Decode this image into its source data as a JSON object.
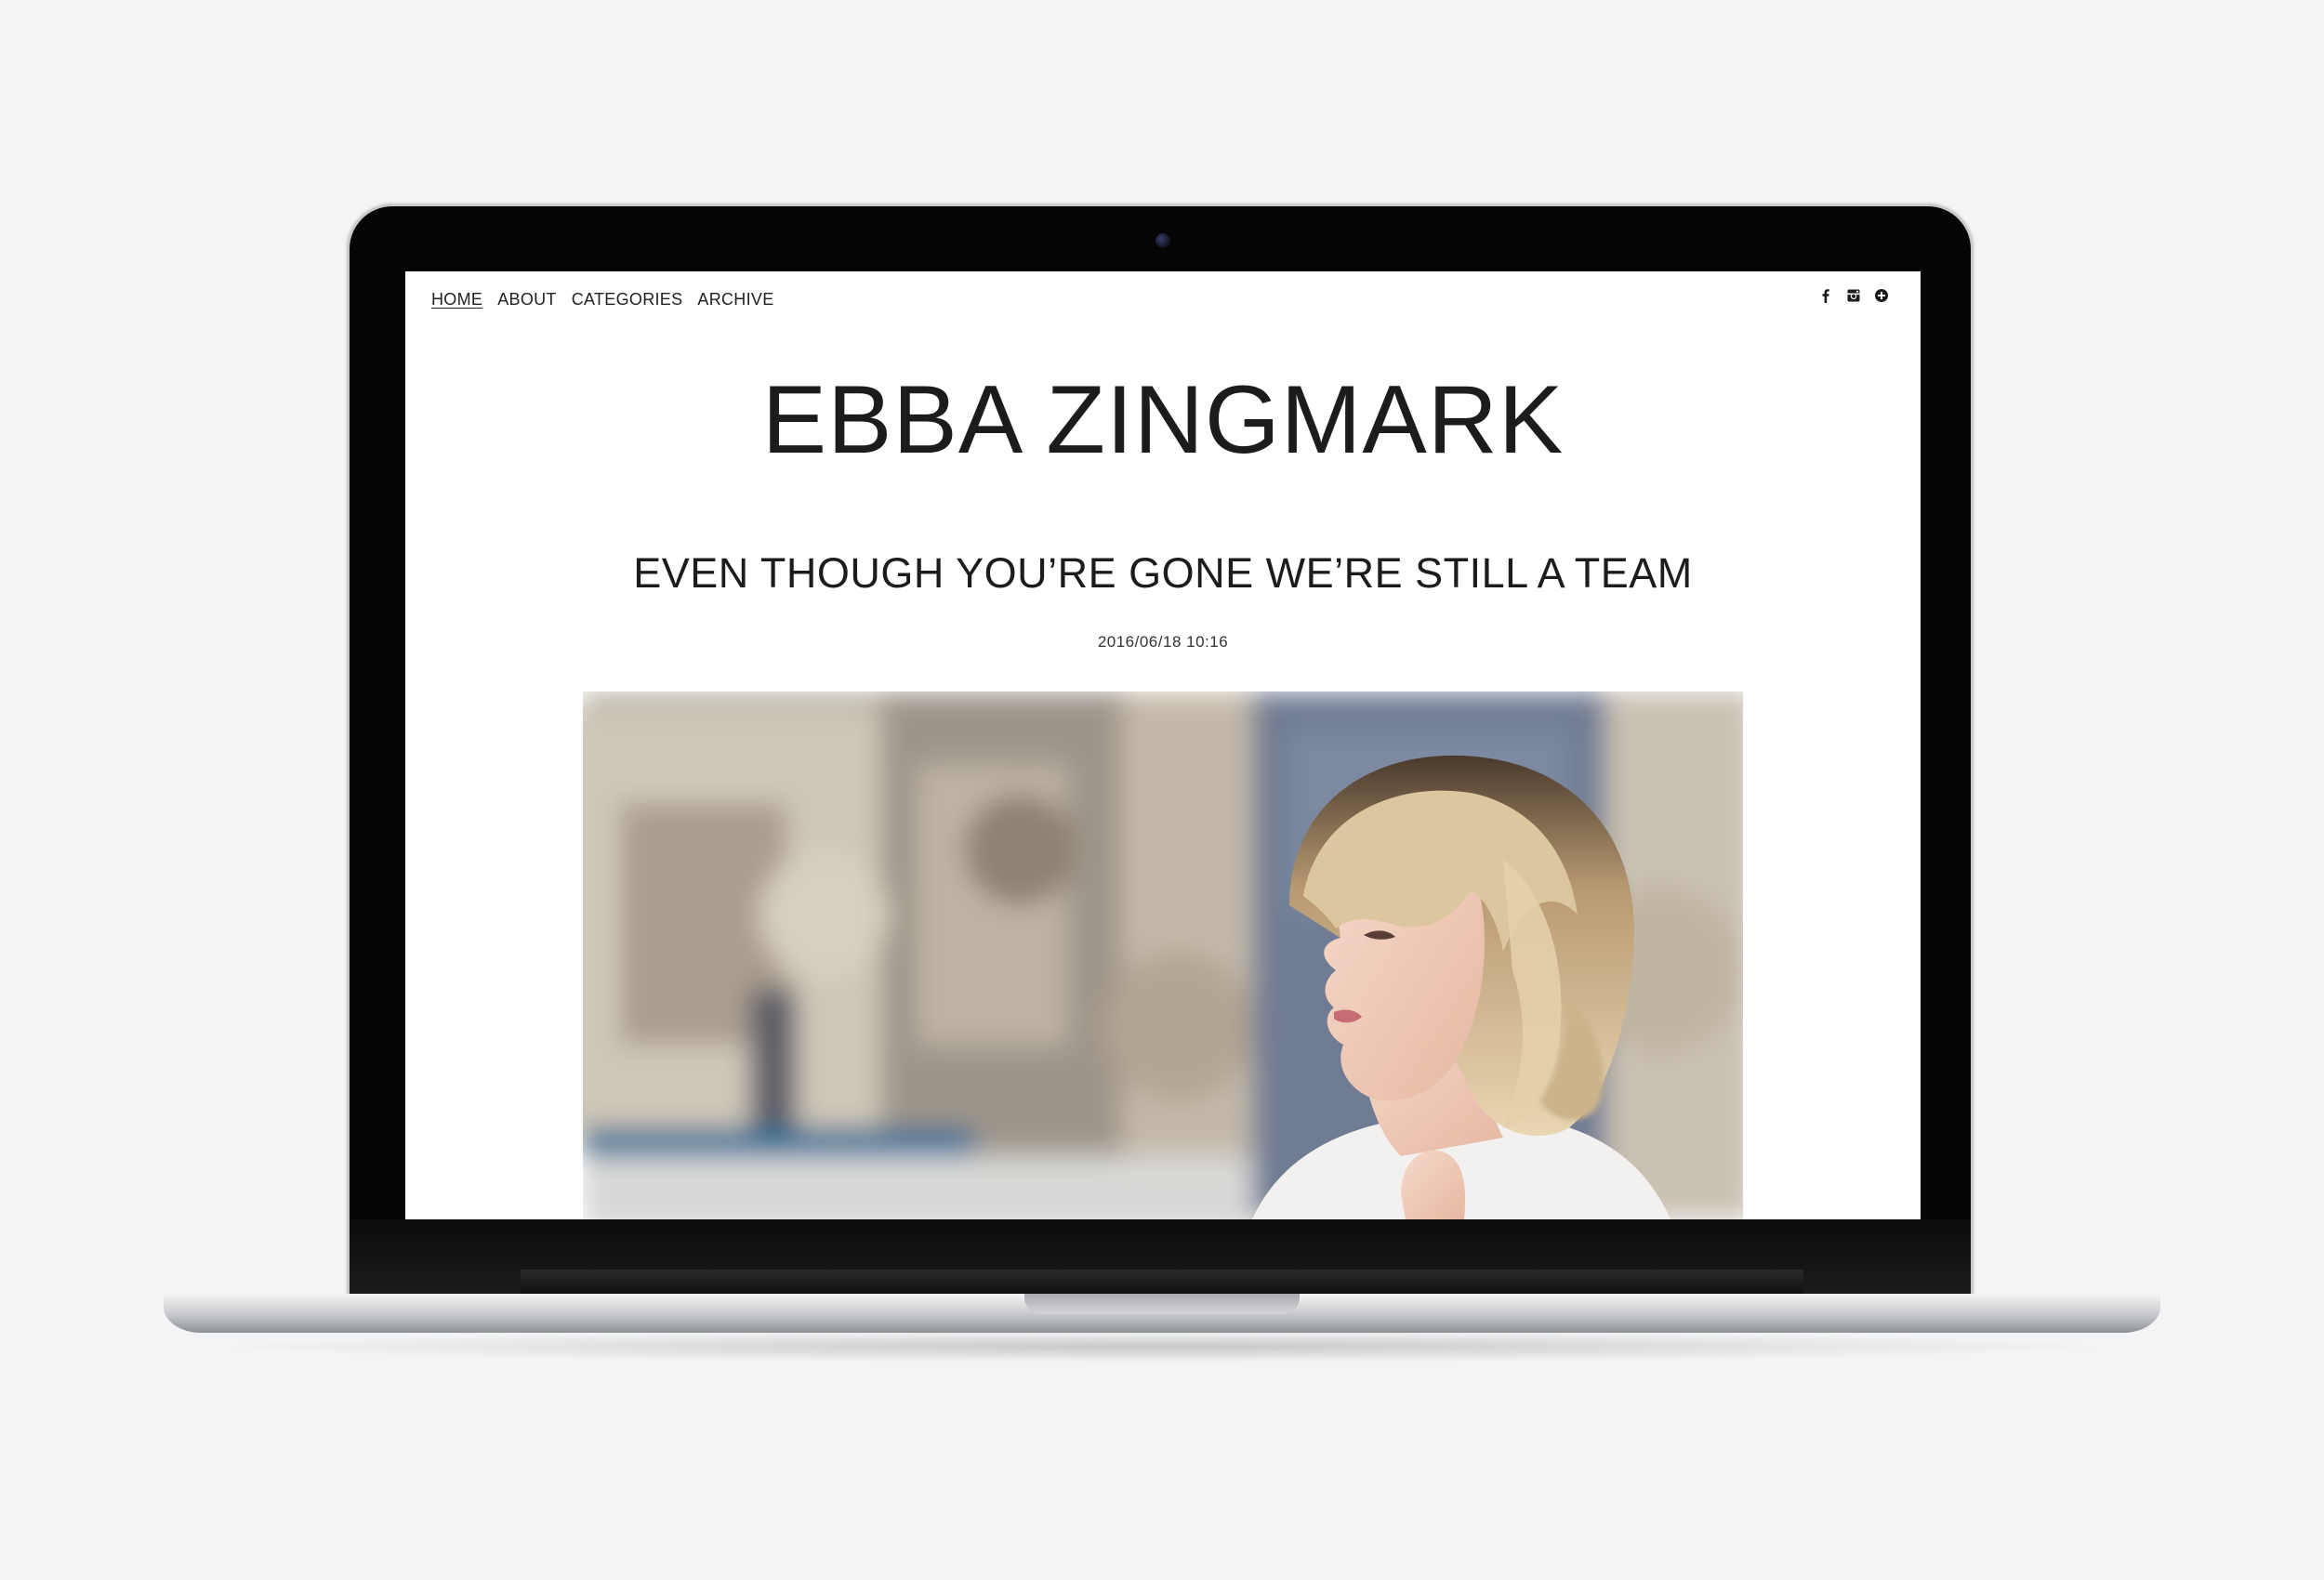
{
  "nav": {
    "items": [
      {
        "label": "HOME",
        "active": true
      },
      {
        "label": "ABOUT",
        "active": false
      },
      {
        "label": "CATEGORIES",
        "active": false
      },
      {
        "label": "ARCHIVE",
        "active": false
      }
    ]
  },
  "social": {
    "icons": [
      "facebook-icon",
      "instagram-icon",
      "bloglovin-plus-icon"
    ]
  },
  "site": {
    "title": "EBBA ZINGMARK"
  },
  "post": {
    "title": "EVEN THOUGH YOU’RE GONE WE’RE STILL A TEAM",
    "date": "2016/06/18 10:16"
  },
  "colors": {
    "background": "#f3f4f5",
    "text": "#1c1c1c",
    "bezel": "#050505",
    "aluminium": "#d7d9db"
  }
}
